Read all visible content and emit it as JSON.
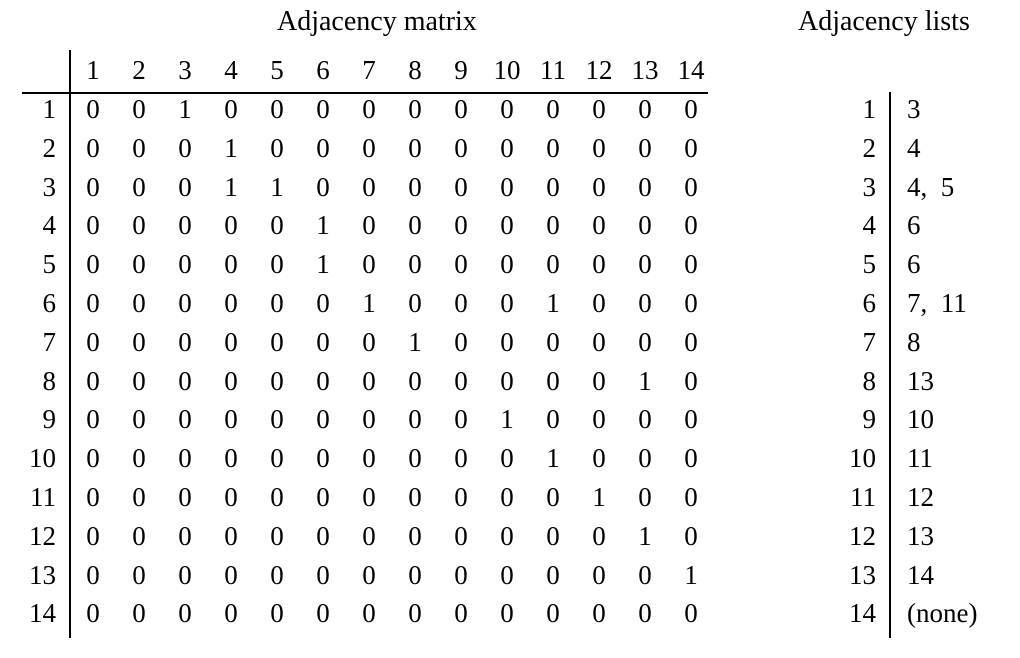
{
  "matrix_title": "Adjacency matrix",
  "lists_title": "Adjacency lists",
  "column_headers": [
    "1",
    "2",
    "3",
    "4",
    "5",
    "6",
    "7",
    "8",
    "9",
    "10",
    "11",
    "12",
    "13",
    "14"
  ],
  "matrix_rows": [
    {
      "label": "1",
      "cells": [
        "0",
        "0",
        "1",
        "0",
        "0",
        "0",
        "0",
        "0",
        "0",
        "0",
        "0",
        "0",
        "0",
        "0"
      ]
    },
    {
      "label": "2",
      "cells": [
        "0",
        "0",
        "0",
        "1",
        "0",
        "0",
        "0",
        "0",
        "0",
        "0",
        "0",
        "0",
        "0",
        "0"
      ]
    },
    {
      "label": "3",
      "cells": [
        "0",
        "0",
        "0",
        "1",
        "1",
        "0",
        "0",
        "0",
        "0",
        "0",
        "0",
        "0",
        "0",
        "0"
      ]
    },
    {
      "label": "4",
      "cells": [
        "0",
        "0",
        "0",
        "0",
        "0",
        "1",
        "0",
        "0",
        "0",
        "0",
        "0",
        "0",
        "0",
        "0"
      ]
    },
    {
      "label": "5",
      "cells": [
        "0",
        "0",
        "0",
        "0",
        "0",
        "1",
        "0",
        "0",
        "0",
        "0",
        "0",
        "0",
        "0",
        "0"
      ]
    },
    {
      "label": "6",
      "cells": [
        "0",
        "0",
        "0",
        "0",
        "0",
        "0",
        "1",
        "0",
        "0",
        "0",
        "1",
        "0",
        "0",
        "0"
      ]
    },
    {
      "label": "7",
      "cells": [
        "0",
        "0",
        "0",
        "0",
        "0",
        "0",
        "0",
        "1",
        "0",
        "0",
        "0",
        "0",
        "0",
        "0"
      ]
    },
    {
      "label": "8",
      "cells": [
        "0",
        "0",
        "0",
        "0",
        "0",
        "0",
        "0",
        "0",
        "0",
        "0",
        "0",
        "0",
        "1",
        "0"
      ]
    },
    {
      "label": "9",
      "cells": [
        "0",
        "0",
        "0",
        "0",
        "0",
        "0",
        "0",
        "0",
        "0",
        "1",
        "0",
        "0",
        "0",
        "0"
      ]
    },
    {
      "label": "10",
      "cells": [
        "0",
        "0",
        "0",
        "0",
        "0",
        "0",
        "0",
        "0",
        "0",
        "0",
        "1",
        "0",
        "0",
        "0"
      ]
    },
    {
      "label": "11",
      "cells": [
        "0",
        "0",
        "0",
        "0",
        "0",
        "0",
        "0",
        "0",
        "0",
        "0",
        "0",
        "1",
        "0",
        "0"
      ]
    },
    {
      "label": "12",
      "cells": [
        "0",
        "0",
        "0",
        "0",
        "0",
        "0",
        "0",
        "0",
        "0",
        "0",
        "0",
        "0",
        "1",
        "0"
      ]
    },
    {
      "label": "13",
      "cells": [
        "0",
        "0",
        "0",
        "0",
        "0",
        "0",
        "0",
        "0",
        "0",
        "0",
        "0",
        "0",
        "0",
        "1"
      ]
    },
    {
      "label": "14",
      "cells": [
        "0",
        "0",
        "0",
        "0",
        "0",
        "0",
        "0",
        "0",
        "0",
        "0",
        "0",
        "0",
        "0",
        "0"
      ]
    }
  ],
  "adjacency_lists": [
    {
      "node": "1",
      "neighbors": "3"
    },
    {
      "node": "2",
      "neighbors": "4"
    },
    {
      "node": "3",
      "neighbors": "4,  5"
    },
    {
      "node": "4",
      "neighbors": "6"
    },
    {
      "node": "5",
      "neighbors": "6"
    },
    {
      "node": "6",
      "neighbors": "7,  11"
    },
    {
      "node": "7",
      "neighbors": "8"
    },
    {
      "node": "8",
      "neighbors": "13"
    },
    {
      "node": "9",
      "neighbors": "10"
    },
    {
      "node": "10",
      "neighbors": "11"
    },
    {
      "node": "11",
      "neighbors": "12"
    },
    {
      "node": "12",
      "neighbors": "13"
    },
    {
      "node": "13",
      "neighbors": "14"
    },
    {
      "node": "14",
      "neighbors": "(none)"
    }
  ]
}
